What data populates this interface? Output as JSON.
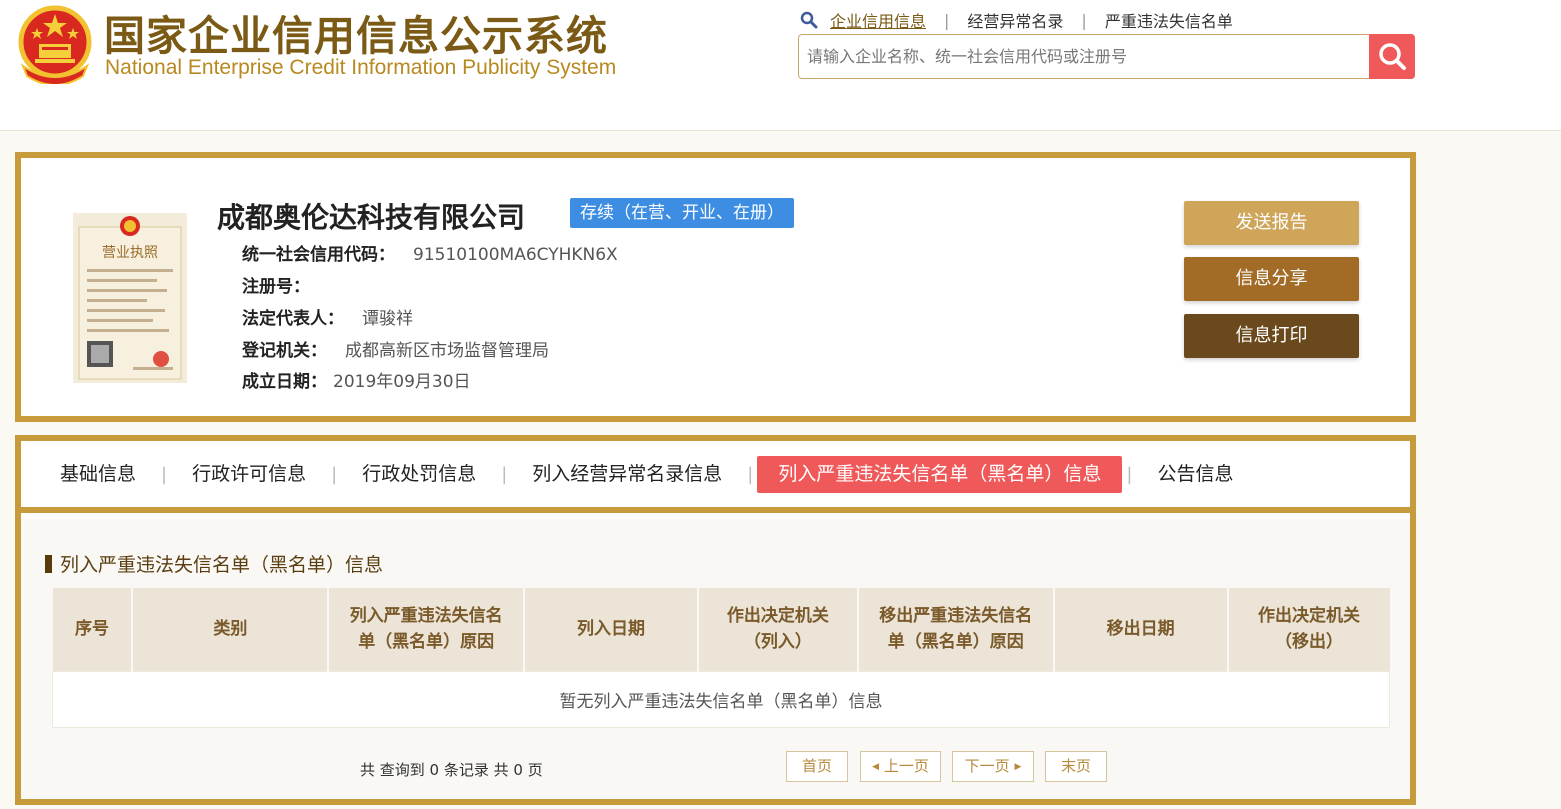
{
  "header": {
    "title_cn": "国家企业信用信息公示系统",
    "title_en": "National Enterprise Credit Information Publicity System",
    "links": [
      "企业信用信息",
      "经营异常名录",
      "严重违法失信名单"
    ],
    "search_placeholder": "请输入企业名称、统一社会信用代码或注册号"
  },
  "company": {
    "name": "成都奥伦达科技有限公司",
    "status": "存续（在营、开业、在册）",
    "license_title": "营业执照",
    "fields": [
      {
        "label": "统一社会信用代码：",
        "value": "91510100MA6CYHKN6X"
      },
      {
        "label": "注册号：",
        "value": ""
      },
      {
        "label": "法定代表人：",
        "value": "谭骏祥"
      },
      {
        "label": "登记机关：",
        "value": "成都高新区市场监督管理局"
      },
      {
        "label": "成立日期：",
        "value": "2019年09月30日"
      }
    ],
    "buttons": {
      "send": "发送报告",
      "share": "信息分享",
      "print": "信息打印"
    }
  },
  "tabs": [
    "基础信息",
    "行政许可信息",
    "行政处罚信息",
    "列入经营异常名录信息",
    "列入严重违法失信名单（黑名单）信息",
    "公告信息"
  ],
  "section": {
    "title": "列入严重违法失信名单（黑名单）信息",
    "columns": [
      [
        "序号"
      ],
      [
        "类别"
      ],
      [
        "列入严重违法失信名",
        "单（黑名单）原因"
      ],
      [
        "列入日期"
      ],
      [
        "作出决定机关",
        "（列入）"
      ],
      [
        "移出严重违法失信名",
        "单（黑名单）原因"
      ],
      [
        "移出日期"
      ],
      [
        "作出决定机关",
        "（移出）"
      ]
    ],
    "empty_text": "暂无列入严重违法失信名单（黑名单）信息"
  },
  "pagination": {
    "records_text": "共 查询到 0 条记录 共 0 页",
    "first": "首页",
    "prev": "上一页",
    "next": "下一页",
    "last": "末页"
  },
  "colors": {
    "brand_gold": "#c79b3c",
    "active_red": "#f0595a",
    "status_blue": "#3d8ee3"
  }
}
